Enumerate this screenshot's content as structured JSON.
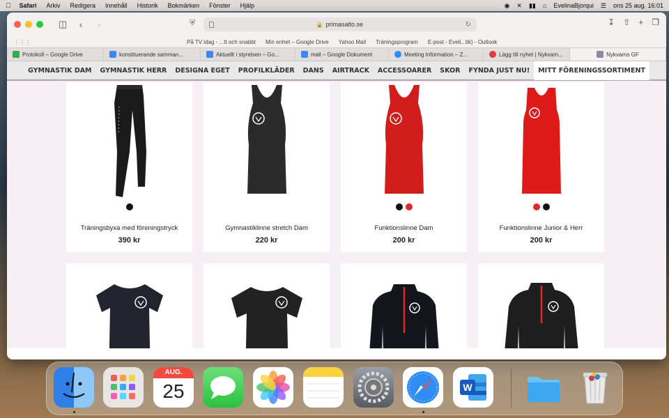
{
  "menubar": {
    "app": "Safari",
    "items": [
      "Arkiv",
      "Redigera",
      "Innehåll",
      "Historik",
      "Bokmärken",
      "Fönster",
      "Hjälp"
    ],
    "user": "EvelinaBjorqui",
    "datetime": "ons 25 aug.  16:01"
  },
  "browser": {
    "url": "primasalto.se",
    "favorites": [
      "På TV idag - ...tt och snabbt",
      "Min enhet – Google Drive",
      "Yahoo Mail",
      "Träningsprogram",
      "E-post - Eveli...tik) - Outlook"
    ],
    "tabs": [
      {
        "label": "Protokoll – Google Drive",
        "color": "#34a853"
      },
      {
        "label": "konstituerande samman...",
        "color": "#4285f4"
      },
      {
        "label": "Aktuellt i styrelsen – Go...",
        "color": "#4285f4"
      },
      {
        "label": "mall – Google Dokument",
        "color": "#4285f4"
      },
      {
        "label": "Meeting Information – Z...",
        "color": "#2d8cff"
      },
      {
        "label": "Lägg till nyhet | Nykvarn...",
        "color": "#e23b3b"
      },
      {
        "label": "Nykvarns GF",
        "color": "#8a8aa0"
      }
    ]
  },
  "site": {
    "nav": [
      "GYMNASTIK DAM",
      "GYMNASTIK HERR",
      "DESIGNA EGET",
      "PROFILKLÄDER",
      "DANS",
      "AIRTRACK",
      "ACCESSOARER",
      "SKOR",
      "FYNDA JUST NU!",
      "MITT FÖRENINGSSORTIMENT"
    ],
    "active_nav": "MITT FÖRENINGSSORTIMENT",
    "products": [
      {
        "name": "Träningsbyxa med föreningstryck",
        "price": "390 kr",
        "swatches": [
          "#111111"
        ],
        "image": "leggings-black"
      },
      {
        "name": "Gymnastiklinne stretch Dam",
        "price": "220 kr",
        "swatches": [],
        "image": "racerback-tank-black"
      },
      {
        "name": "Funktionslinne Dam",
        "price": "200 kr",
        "swatches": [
          "#111111",
          "#e02a2a"
        ],
        "image": "racerback-tank-red"
      },
      {
        "name": "Funktionslinne Junior & Herr",
        "price": "200 kr",
        "swatches": [
          "#e02a2a",
          "#111111"
        ],
        "image": "tank-red"
      },
      {
        "name": "",
        "price": "",
        "swatches": [],
        "image": "tshirt-women-navy"
      },
      {
        "name": "",
        "price": "",
        "swatches": [],
        "image": "tshirt-black"
      },
      {
        "name": "",
        "price": "",
        "swatches": [],
        "image": "halfzip-women-black"
      },
      {
        "name": "",
        "price": "",
        "swatches": [],
        "image": "halfzip-black"
      }
    ]
  },
  "dock": {
    "calendar_month": "AUG.",
    "calendar_day": "25",
    "apps": [
      "finder",
      "launchpad",
      "calendar",
      "messages",
      "photos",
      "notes",
      "system-preferences",
      "safari",
      "word",
      "downloads-folder",
      "trash"
    ]
  }
}
